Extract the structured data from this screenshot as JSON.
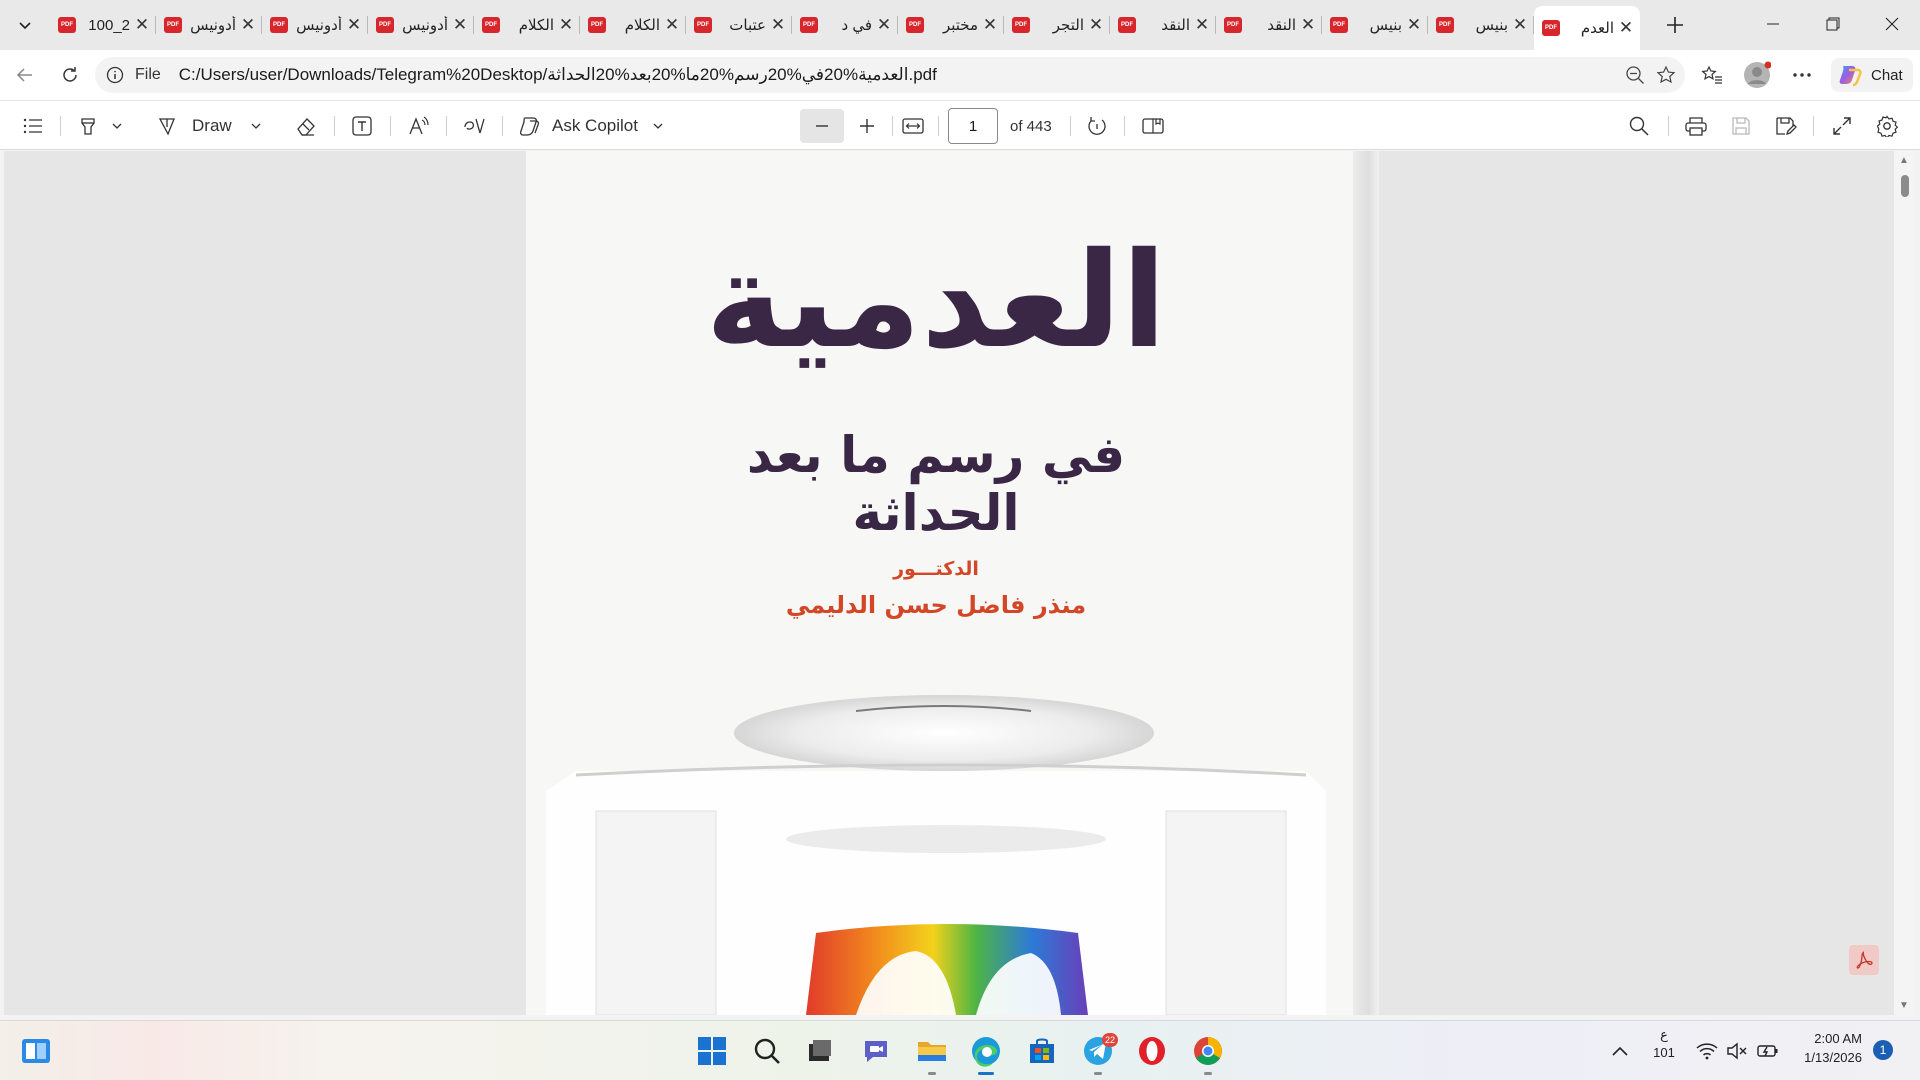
{
  "browser": {
    "tabs": [
      {
        "title": "2_100"
      },
      {
        "title": "أدونيس"
      },
      {
        "title": "أدونيس"
      },
      {
        "title": "أدونيس"
      },
      {
        "title": "الكلام"
      },
      {
        "title": "الكلام"
      },
      {
        "title": "عتبات"
      },
      {
        "title": "في د"
      },
      {
        "title": "مختبر"
      },
      {
        "title": "التجر"
      },
      {
        "title": "النقد"
      },
      {
        "title": "النقد"
      },
      {
        "title": "بنيس"
      },
      {
        "title": "بنيس"
      },
      {
        "title": "العدم"
      }
    ],
    "active_tab_index": 14,
    "address_scheme": "File",
    "address_url": "C:/Users/user/Downloads/Telegram%20Desktop/العدمية%20في%20رسم%20ما%20بعد%20الحداثة.pdf",
    "chat_label": "Chat"
  },
  "pdf_toolbar": {
    "draw_label": "Draw",
    "ask_copilot_label": "Ask Copilot",
    "current_page": "1",
    "page_total_label": "of 443"
  },
  "document": {
    "title": "العدمية",
    "subtitle": "في رسم ما بعد الحداثة",
    "author_prefix": "الدكتـــور",
    "author": "منذر فاضل حسن الدليمي"
  },
  "taskbar": {
    "telegram_badge": "22",
    "tray_lang": "ع",
    "tray_lang_num": "101",
    "time": "2:00 AM",
    "date": "1/13/2026",
    "notification_count": "1"
  },
  "colors": {
    "title_color": "#3a2746",
    "author_color": "#d34727",
    "pdf_badge": "#d7262c",
    "accent": "#1a73c9"
  }
}
